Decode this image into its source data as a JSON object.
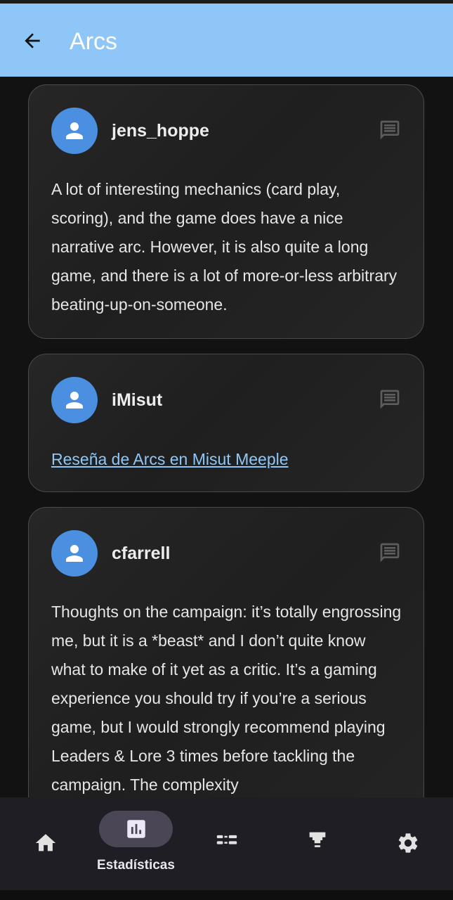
{
  "appbar": {
    "title": "Arcs"
  },
  "reviews": [
    {
      "username": "jens_hoppe",
      "text": "A lot of interesting mechanics (card play, scoring), and the game does have a nice narrative arc. However, it is also quite a long game, and there is a lot of more-or-less arbitrary beating-up-on-someone."
    },
    {
      "username": "iMisut",
      "link_text": "Reseña de Arcs en Misut Meeple"
    },
    {
      "username": "cfarrell",
      "text": "Thoughts on the campaign: it’s totally engrossing me, but it is a *beast* and I don’t quite know what to make of it yet as a critic. It’s a gaming experience you should try if you’re a serious game, but I would strongly recommend playing Leaders & Lore 3 times before tackling the campaign. The complexity"
    }
  ],
  "bottom_nav": {
    "items": [
      {
        "icon": "home-icon"
      },
      {
        "icon": "bar-chart-icon",
        "label": "Estadísticas",
        "selected": true
      },
      {
        "icon": "list-icon"
      },
      {
        "icon": "meeple-icon"
      },
      {
        "icon": "gear-icon"
      }
    ]
  },
  "colors": {
    "appbar": "#8ec7f7",
    "avatar": "#4a8fe0",
    "link": "#8ec7f7",
    "background": "#121212"
  }
}
